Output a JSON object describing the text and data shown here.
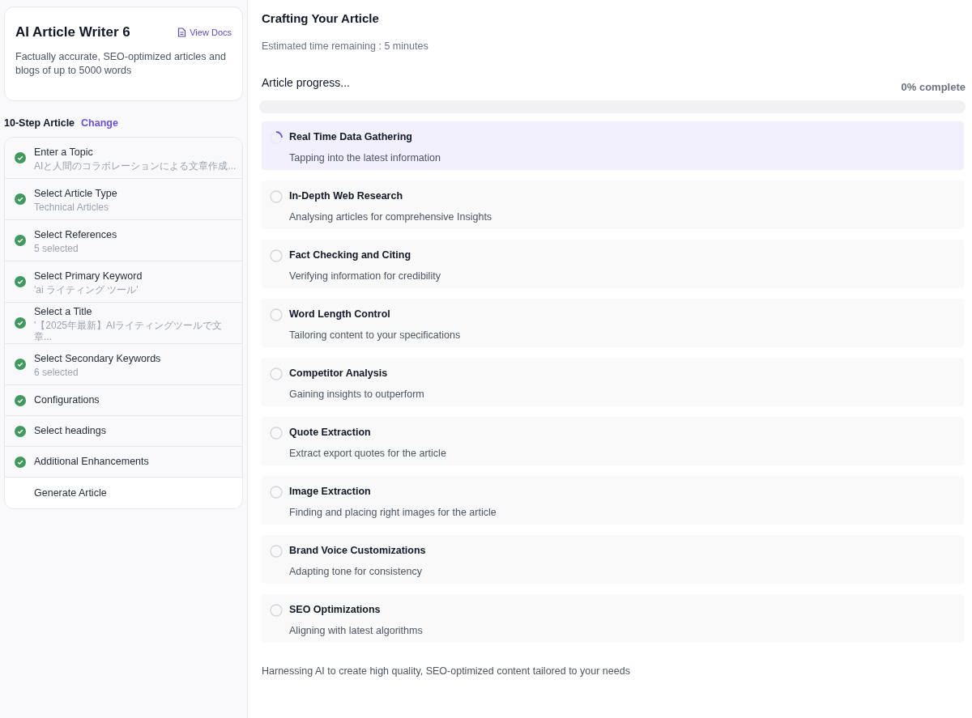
{
  "sidebar": {
    "title": "AI Article Writer 6",
    "docs_link": "View Docs",
    "description": "Factually accurate, SEO-optimized articles and blogs of up to 5000 words",
    "plan_label": "10-Step Article",
    "change_link": "Change",
    "steps": [
      {
        "label": "Enter a Topic",
        "detail": "AIと人間のコラボレーションによる文章作成...",
        "done": true
      },
      {
        "label": "Select Article Type",
        "detail": "Technical Articles",
        "done": true
      },
      {
        "label": "Select References",
        "detail": "5 selected",
        "done": true
      },
      {
        "label": "Select Primary Keyword",
        "detail": "'ai ライティング ツール'",
        "done": true
      },
      {
        "label": "Select a Title",
        "detail": "'【2025年最新】AIライティングツールで文章...",
        "done": true
      },
      {
        "label": "Select Secondary Keywords",
        "detail": "6 selected",
        "done": true
      },
      {
        "label": "Configurations",
        "done": true
      },
      {
        "label": "Select headings",
        "done": true
      },
      {
        "label": "Additional Enhancements",
        "done": true
      },
      {
        "label": "Generate Article",
        "done": false
      }
    ]
  },
  "main": {
    "title": "Crafting Your Article",
    "estimate": "Estimated time remaining : 5 minutes",
    "progress_label": "Article progress...",
    "progress_reading": "0% complete",
    "progress": {
      "level": 0
    },
    "tasks": [
      {
        "title": "Real Time Data Gathering",
        "subtitle": "Tapping into the latest information",
        "active": true
      },
      {
        "title": "In-Depth Web Research",
        "subtitle": "Analysing articles for comprehensive Insights",
        "active": false
      },
      {
        "title": "Fact Checking and Citing",
        "subtitle": "Verifying information for credibility",
        "active": false
      },
      {
        "title": "Word Length Control",
        "subtitle": "Tailoring content to your specifications",
        "active": false
      },
      {
        "title": "Competitor Analysis",
        "subtitle": "Gaining insights to outperform",
        "active": false
      },
      {
        "title": "Quote Extraction",
        "subtitle": "Extract export quotes for the article",
        "active": false
      },
      {
        "title": "Image Extraction",
        "subtitle": "Finding and placing right images for the article",
        "active": false
      },
      {
        "title": "Brand Voice Customizations",
        "subtitle": "Adapting tone for consistency",
        "active": false
      },
      {
        "title": "SEO Optimizations",
        "subtitle": "Aligning with latest algorithms",
        "active": false
      }
    ],
    "footer": "Harnessing AI to create high quality, SEO-optimized content tailored to your needs"
  }
}
